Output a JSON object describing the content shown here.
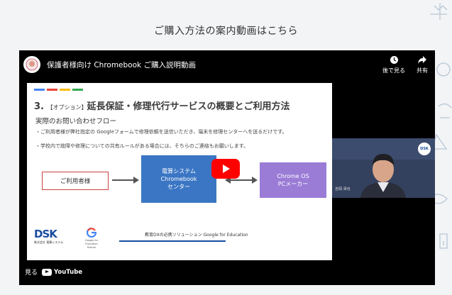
{
  "page": {
    "heading": "ご購入方法の案内動画はこちら"
  },
  "player": {
    "title": "保護者様向け Chromebook ご購入説明動画",
    "actions": [
      {
        "label": "後で見る",
        "icon": "clock-icon"
      },
      {
        "label": "共有",
        "icon": "share-arrow-icon"
      }
    ],
    "bottom": {
      "watch_on": "見る",
      "youtube": "YouTube"
    }
  },
  "slide": {
    "number": "3.",
    "option_tag": "【オプション】",
    "title": "延長保証・修理代行サービスの概要とご利用方法",
    "subtitle": "実際のお問い合わせフロー",
    "bullets": [
      "・ご利用者様が弊社指定の Googleフォームで修理依頼を送信いただき、端末を修理センターへを送るだけです。",
      "・学校内で故障や修理についての共有ルールがある場合には、そちらのご連絡もお願いします。"
    ],
    "flow": {
      "user": "ご利用者様",
      "center_line1": "電算システム",
      "center_line2": "Chromebook",
      "center_line3": "センター",
      "maker_line1": "Chrome OS",
      "maker_line2": "PCメーカー"
    },
    "footer": {
      "dsk": "DSK",
      "dsk_company": "株式会社 電算システム",
      "google_sub": "Google for Education Partner",
      "edu_text": "教育DXの必携ソリューション Google for Education"
    },
    "stripe_colors": [
      "#4285f4",
      "#ea4335",
      "#fbbc05",
      "#34a853"
    ]
  },
  "webcam": {
    "badge": "DSK",
    "name": "吉岡 澤也"
  }
}
